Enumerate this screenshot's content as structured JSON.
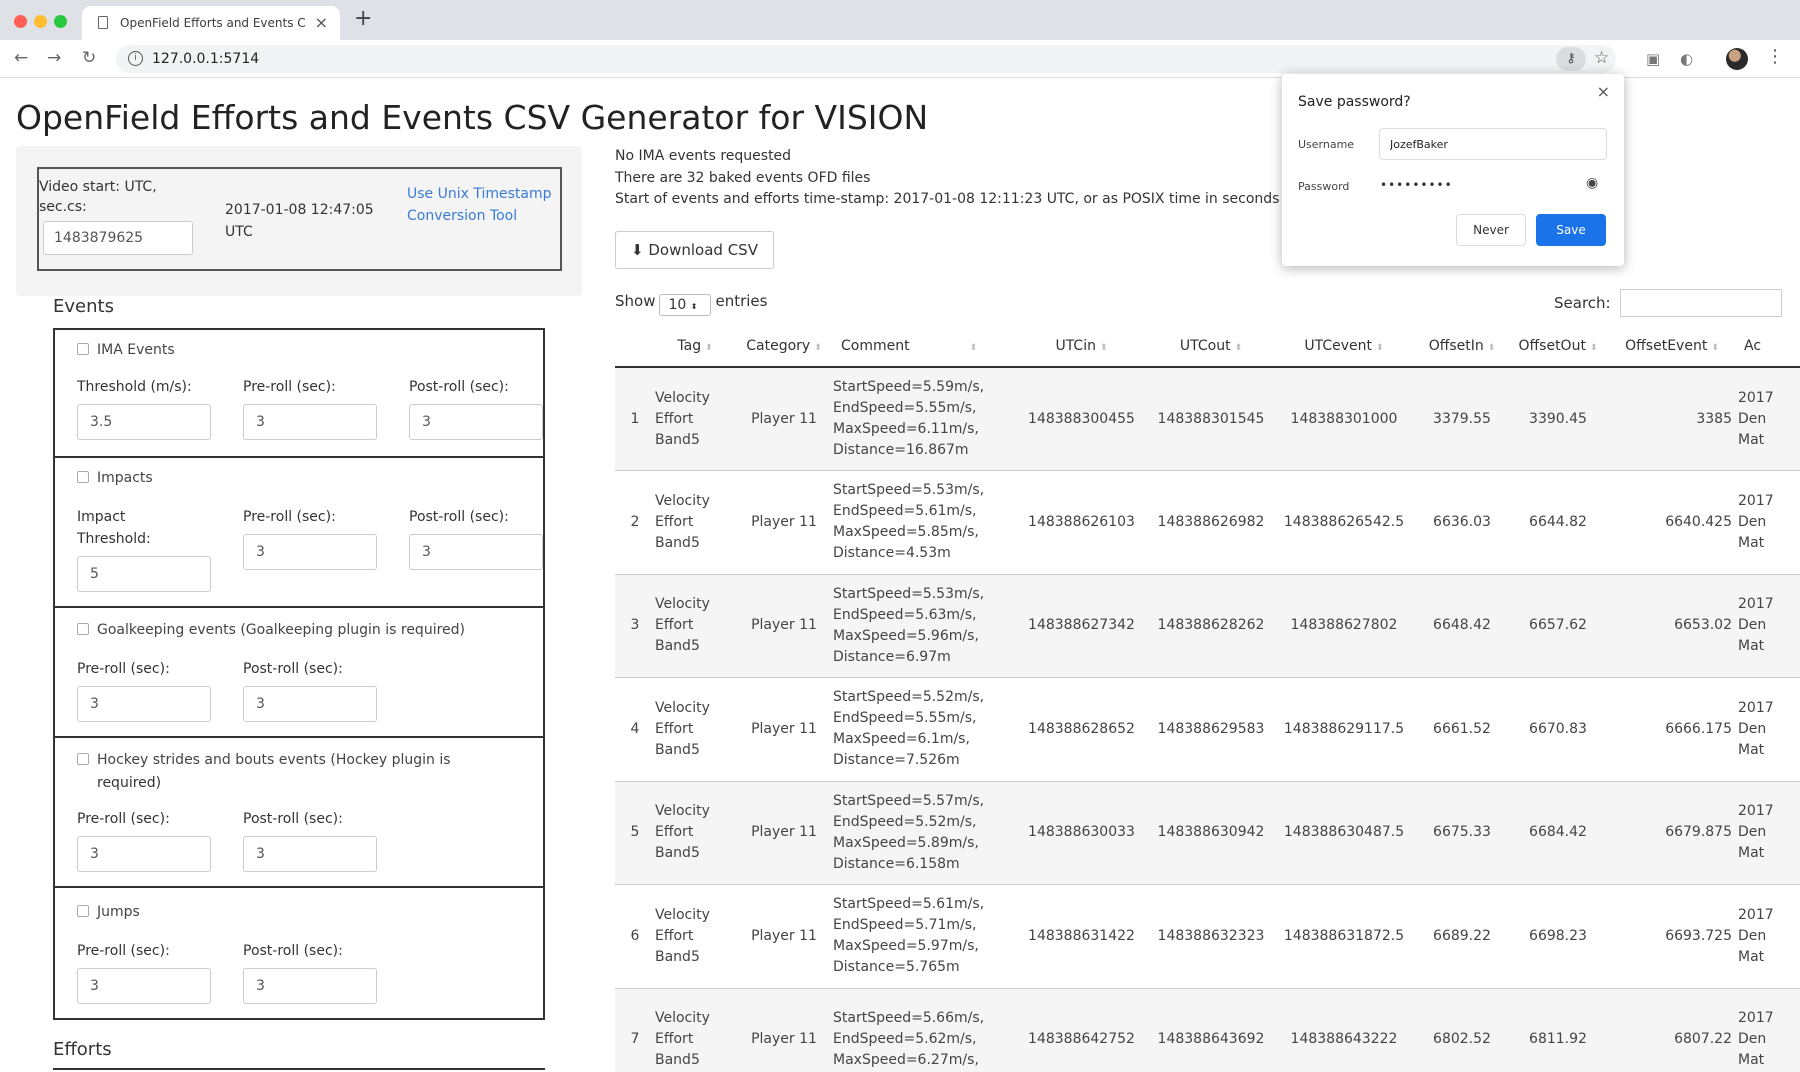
{
  "browser": {
    "tab_title": "OpenField Efforts and Events C",
    "url": "127.0.0.1:5714",
    "traffic_lights": [
      "#ff5f57",
      "#febc2e",
      "#28c840"
    ]
  },
  "page": {
    "title": "OpenField Efforts and Events CSV Generator for VISION"
  },
  "video": {
    "label": "Video start: UTC, sec.cs:",
    "value": "1483879625",
    "date": "2017-01-08 12:47:05 UTC",
    "link": "Use Unix Timestamp Conversion Tool"
  },
  "events": {
    "heading": "Events",
    "ima": {
      "label": "IMA Events",
      "threshold_label": "Threshold (m/s):",
      "threshold": "3.5",
      "preroll_label": "Pre-roll (sec):",
      "preroll": "3",
      "postroll_label": "Post-roll (sec):",
      "postroll": "3"
    },
    "impacts": {
      "label": "Impacts",
      "threshold_label": "Impact Threshold:",
      "threshold": "5",
      "preroll_label": "Pre-roll (sec):",
      "preroll": "3",
      "postroll_label": "Post-roll (sec):",
      "postroll": "3"
    },
    "goalkeeping": {
      "label": "Goalkeeping events (Goalkeeping plugin is required)",
      "preroll_label": "Pre-roll (sec):",
      "preroll": "3",
      "postroll_label": "Post-roll (sec):",
      "postroll": "3"
    },
    "hockey": {
      "label_line1": "Hockey strides and bouts events (Hockey plugin is",
      "label_line2": "required)",
      "preroll_label": "Pre-roll (sec):",
      "preroll": "3",
      "postroll_label": "Post-roll (sec):",
      "postroll": "3"
    },
    "jumps": {
      "label": "Jumps",
      "preroll_label": "Pre-roll (sec):",
      "preroll": "3",
      "postroll_label": "Post-roll (sec):",
      "postroll": "3"
    }
  },
  "efforts": {
    "heading": "Efforts"
  },
  "status": {
    "line1": "No IMA events requested",
    "line2": "There are 32 baked events OFD files",
    "line3": "Start of events and efforts time-stamp: 2017-01-08 12:11:23 UTC, or as POSIX time in seconds"
  },
  "download_label": "Download CSV",
  "table_controls": {
    "show": "Show",
    "entries_value": "10",
    "entries": "entries",
    "search": "Search:"
  },
  "table": {
    "columns": [
      "Tag",
      "Category",
      "Comment",
      "UTCin",
      "UTCout",
      "UTCevent",
      "OffsetIn",
      "OffsetOut",
      "OffsetEvent",
      "Ac"
    ],
    "rows": [
      {
        "idx": "1",
        "tag": [
          "Velocity",
          "Effort",
          "Band5"
        ],
        "category": "Player 11",
        "comment": [
          "StartSpeed=5.59m/s,",
          "EndSpeed=5.55m/s,",
          "MaxSpeed=6.11m/s,",
          "Distance=16.867m"
        ],
        "utcin": "148388300455",
        "utcout": "148388301545",
        "utcevent": "148388301000",
        "offsetin": "3379.55",
        "offsetout": "3390.45",
        "offsetevent": "3385",
        "ac": [
          "2017",
          "Den",
          "Mat"
        ]
      },
      {
        "idx": "2",
        "tag": [
          "Velocity",
          "Effort",
          "Band5"
        ],
        "category": "Player 11",
        "comment": [
          "StartSpeed=5.53m/s,",
          "EndSpeed=5.61m/s,",
          "MaxSpeed=5.85m/s,",
          "Distance=4.53m"
        ],
        "utcin": "148388626103",
        "utcout": "148388626982",
        "utcevent": "148388626542.5",
        "offsetin": "6636.03",
        "offsetout": "6644.82",
        "offsetevent": "6640.425",
        "ac": [
          "2017",
          "Den",
          "Mat"
        ]
      },
      {
        "idx": "3",
        "tag": [
          "Velocity",
          "Effort",
          "Band5"
        ],
        "category": "Player 11",
        "comment": [
          "StartSpeed=5.53m/s,",
          "EndSpeed=5.63m/s,",
          "MaxSpeed=5.96m/s,",
          "Distance=6.97m"
        ],
        "utcin": "148388627342",
        "utcout": "148388628262",
        "utcevent": "148388627802",
        "offsetin": "6648.42",
        "offsetout": "6657.62",
        "offsetevent": "6653.02",
        "ac": [
          "2017",
          "Den",
          "Mat"
        ]
      },
      {
        "idx": "4",
        "tag": [
          "Velocity",
          "Effort",
          "Band5"
        ],
        "category": "Player 11",
        "comment": [
          "StartSpeed=5.52m/s,",
          "EndSpeed=5.55m/s,",
          "MaxSpeed=6.1m/s,",
          "Distance=7.526m"
        ],
        "utcin": "148388628652",
        "utcout": "148388629583",
        "utcevent": "148388629117.5",
        "offsetin": "6661.52",
        "offsetout": "6670.83",
        "offsetevent": "6666.175",
        "ac": [
          "2017",
          "Den",
          "Mat"
        ]
      },
      {
        "idx": "5",
        "tag": [
          "Velocity",
          "Effort",
          "Band5"
        ],
        "category": "Player 11",
        "comment": [
          "StartSpeed=5.57m/s,",
          "EndSpeed=5.52m/s,",
          "MaxSpeed=5.89m/s,",
          "Distance=6.158m"
        ],
        "utcin": "148388630033",
        "utcout": "148388630942",
        "utcevent": "148388630487.5",
        "offsetin": "6675.33",
        "offsetout": "6684.42",
        "offsetevent": "6679.875",
        "ac": [
          "2017",
          "Den",
          "Mat"
        ]
      },
      {
        "idx": "6",
        "tag": [
          "Velocity",
          "Effort",
          "Band5"
        ],
        "category": "Player 11",
        "comment": [
          "StartSpeed=5.61m/s,",
          "EndSpeed=5.71m/s,",
          "MaxSpeed=5.97m/s,",
          "Distance=5.765m"
        ],
        "utcin": "148388631422",
        "utcout": "148388632323",
        "utcevent": "148388631872.5",
        "offsetin": "6689.22",
        "offsetout": "6698.23",
        "offsetevent": "6693.725",
        "ac": [
          "2017",
          "Den",
          "Mat"
        ]
      },
      {
        "idx": "7",
        "tag": [
          "Velocity",
          "Effort",
          "Band5"
        ],
        "category": "Player 11",
        "comment": [
          "StartSpeed=5.66m/s,",
          "EndSpeed=5.62m/s,",
          "MaxSpeed=6.27m/s,",
          ""
        ],
        "utcin": "148388642752",
        "utcout": "148388643692",
        "utcevent": "148388643222",
        "offsetin": "6802.52",
        "offsetout": "6811.92",
        "offsetevent": "6807.22",
        "ac": [
          "2017",
          "Den",
          "Mat"
        ]
      }
    ]
  },
  "password_popup": {
    "title": "Save password?",
    "username_label": "Username",
    "username": "JozefBaker",
    "password_label": "Password",
    "password_mask": "•••••••••",
    "never": "Never",
    "save": "Save",
    "accent": "#1a73e8"
  }
}
